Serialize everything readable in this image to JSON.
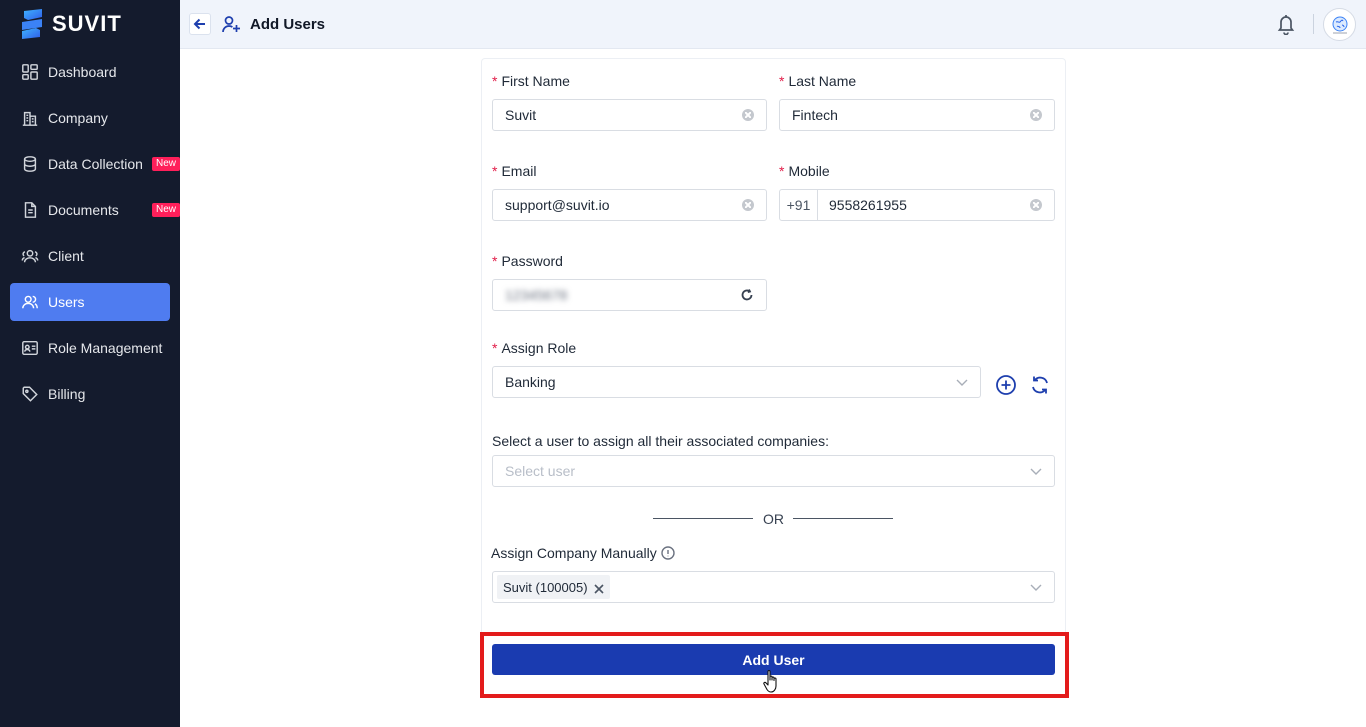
{
  "app": {
    "brand": "SUVIT"
  },
  "sidebar": {
    "items": [
      {
        "label": "Dashboard",
        "icon": "dashboard-icon"
      },
      {
        "label": "Company",
        "icon": "company-icon"
      },
      {
        "label": "Data Collection",
        "icon": "database-icon",
        "badge": "New"
      },
      {
        "label": "Documents",
        "icon": "document-icon",
        "badge": "New"
      },
      {
        "label": "Client",
        "icon": "client-icon"
      },
      {
        "label": "Users",
        "icon": "users-icon",
        "active": true
      },
      {
        "label": "Role Management",
        "icon": "role-icon"
      },
      {
        "label": "Billing",
        "icon": "tag-icon"
      }
    ]
  },
  "header": {
    "title": "Add Users"
  },
  "form": {
    "first_name": {
      "label": "First Name",
      "value": "Suvit"
    },
    "last_name": {
      "label": "Last Name",
      "value": "Fintech"
    },
    "email": {
      "label": "Email",
      "value": "support@suvit.io"
    },
    "mobile": {
      "label": "Mobile",
      "prefix": "+91",
      "value": "9558261955"
    },
    "password": {
      "label": "Password",
      "value": "12345678"
    },
    "assign_role": {
      "label": "Assign Role",
      "value": "Banking"
    },
    "select_user": {
      "label": "Select a user to assign all their associated companies:",
      "placeholder": "Select user"
    },
    "or_text": "OR",
    "assign_company": {
      "label": "Assign Company Manually",
      "tags": [
        "Suvit (100005)"
      ]
    },
    "submit_label": "Add User",
    "required_mark": "*"
  },
  "colors": {
    "sidebar_bg": "#141b2d",
    "active_item": "#4f7cf0",
    "primary_button": "#1a3bb0",
    "badge": "#ff1f5a",
    "highlight": "#e31b1b"
  }
}
